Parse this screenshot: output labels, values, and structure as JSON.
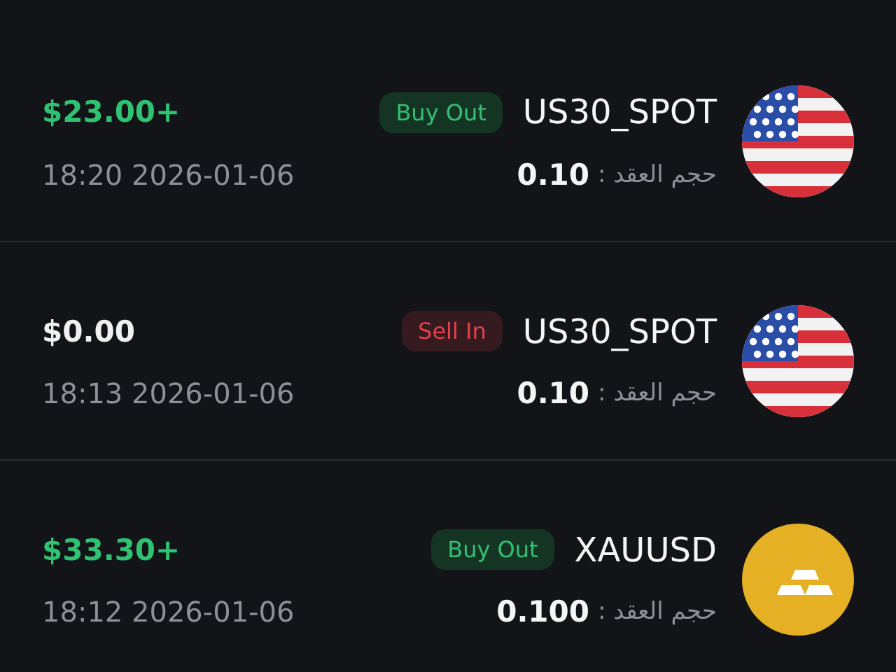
{
  "trades": [
    {
      "icon": {
        "kind": "flag"
      },
      "symbol": "US30_SPOT",
      "side": {
        "kind": "buy",
        "label": "Buy Out"
      },
      "amount": {
        "kind": "profit",
        "text": "$23.00+"
      },
      "date": "18:20 2026-01-06",
      "volume_label": "حجم العقد :",
      "volume": "0.10"
    },
    {
      "icon": {
        "kind": "flag"
      },
      "symbol": "US30_SPOT",
      "side": {
        "kind": "sell",
        "label": "Sell In"
      },
      "amount": {
        "kind": "neutral",
        "text": "$0.00"
      },
      "date": "18:13 2026-01-06",
      "volume_label": "حجم العقد :",
      "volume": "0.10"
    },
    {
      "icon": {
        "kind": "bars"
      },
      "symbol": "XAUUSD",
      "side": {
        "kind": "buy",
        "label": "Buy Out"
      },
      "amount": {
        "kind": "profit",
        "text": "$33.30+"
      },
      "date": "18:12 2026-01-06",
      "volume_label": "حجم العقد :",
      "volume": "0.100"
    }
  ]
}
